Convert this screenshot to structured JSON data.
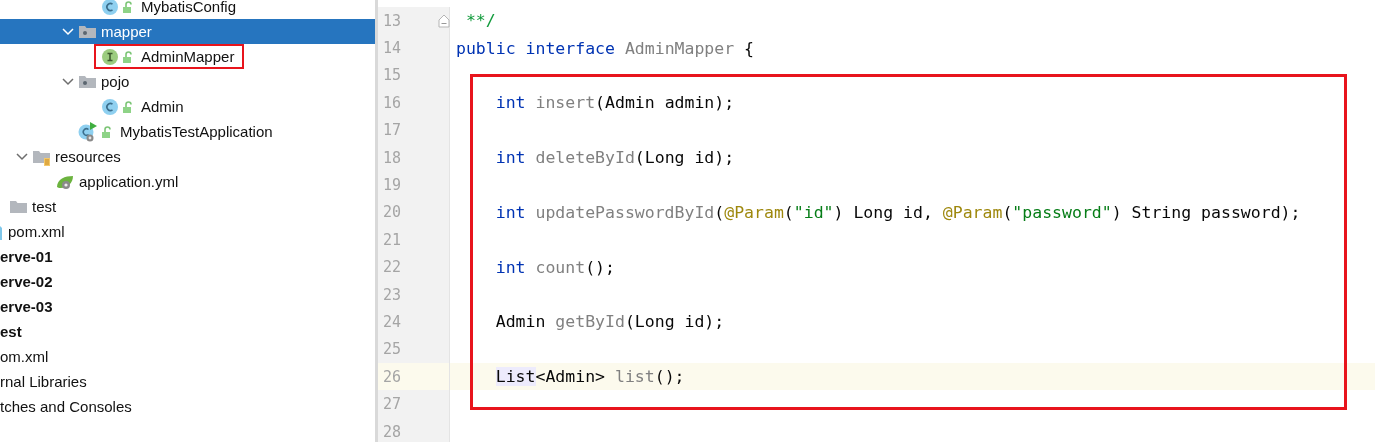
{
  "project_tree": {
    "items": [
      {
        "children": [
          {
            "children": [
              {
                "children": [
                  {
                    "children": [
                      {
                        "children": [
                          {
                            "children": [
                              {
                                "label": "MybatisConfig",
                                "kind": "class",
                                "locked": true,
                                "selected": false
                              }
                            ]
                          },
                          {
                            "label": "mapper",
                            "kind": "package",
                            "expanded": true,
                            "selected": true,
                            "children": [
                              {
                                "label": "AdminMapper",
                                "kind": "interface",
                                "locked": true,
                                "selected": false,
                                "highlighted": true
                              }
                            ]
                          },
                          {
                            "label": "pojo",
                            "kind": "package",
                            "expanded": true,
                            "selected": false,
                            "children": [
                              {
                                "label": "Admin",
                                "kind": "class",
                                "locked": true,
                                "selected": false
                              }
                            ]
                          },
                          {
                            "label": "MybatisTestApplication",
                            "kind": "application",
                            "locked": true,
                            "selected": false
                          }
                        ]
                      }
                    ]
                  },
                  {
                    "label": "resources",
                    "kind": "resources",
                    "expanded": true,
                    "selected": false,
                    "children": [
                      {
                        "label": "application.yml",
                        "kind": "spring_config",
                        "selected": false
                      }
                    ]
                  }
                ]
              },
              {
                "label": "test",
                "kind": "folder",
                "selected": false
              }
            ]
          },
          {
            "label": "pom.xml",
            "kind": "maven",
            "selected": false
          }
        ]
      },
      {
        "label": "erve-01",
        "kind": "module",
        "selected": false
      },
      {
        "label": "erve-02",
        "kind": "module",
        "selected": false
      },
      {
        "label": "erve-03",
        "kind": "module",
        "selected": false
      },
      {
        "label": "est",
        "kind": "module",
        "selected": false
      },
      {
        "label": "om.xml",
        "kind": "file",
        "selected": false
      },
      {
        "label": "rnal Libraries",
        "kind": "file",
        "selected": false
      },
      {
        "label": "tches and Consoles",
        "kind": "file",
        "selected": false
      }
    ]
  },
  "editor": {
    "blocks": [
      {
        "boxed": false,
        "lines": [
          {
            "number": "13",
            "fold": true,
            "tokens": [
              {
                "kind": "doc_comment",
                "text": " **/"
              }
            ]
          },
          {
            "number": "14",
            "tokens": [
              {
                "kind": "keyword",
                "text": "public interface "
              },
              {
                "kind": "unused",
                "text": "AdminMapper"
              },
              {
                "kind": "plain",
                "text": " {"
              }
            ]
          },
          {
            "number": "15"
          }
        ]
      },
      {
        "boxed": true,
        "lines": [
          {
            "number": "16",
            "tokens": [
              {
                "kind": "keyword",
                "text": "    int "
              },
              {
                "kind": "unused",
                "text": "insert"
              },
              {
                "kind": "plain",
                "text": "(Admin admin);"
              }
            ]
          },
          {
            "number": "17"
          },
          {
            "number": "18",
            "tokens": [
              {
                "kind": "keyword",
                "text": "    int "
              },
              {
                "kind": "unused",
                "text": "deleteById"
              },
              {
                "kind": "plain",
                "text": "(Long id);"
              }
            ]
          },
          {
            "number": "19"
          },
          {
            "number": "20",
            "tokens": [
              {
                "kind": "keyword",
                "text": "    int "
              },
              {
                "kind": "unused",
                "text": "updatePasswordById"
              },
              {
                "kind": "plain",
                "text": "("
              },
              {
                "kind": "annotation",
                "text": "@Param"
              },
              {
                "kind": "plain",
                "text": "("
              },
              {
                "kind": "string",
                "text": "\"id\""
              },
              {
                "kind": "plain",
                "text": ") Long id, "
              },
              {
                "kind": "annotation",
                "text": "@Param"
              },
              {
                "kind": "plain",
                "text": "("
              },
              {
                "kind": "string",
                "text": "\"password\""
              },
              {
                "kind": "plain",
                "text": ") String password);"
              }
            ]
          },
          {
            "number": "21"
          },
          {
            "number": "22",
            "tokens": [
              {
                "kind": "keyword",
                "text": "    int "
              },
              {
                "kind": "unused",
                "text": "count"
              },
              {
                "kind": "plain",
                "text": "();"
              }
            ]
          },
          {
            "number": "23"
          },
          {
            "number": "24",
            "tokens": [
              {
                "kind": "plain",
                "text": "    Admin "
              },
              {
                "kind": "unused",
                "text": "getById"
              },
              {
                "kind": "plain",
                "text": "(Long id);"
              }
            ]
          },
          {
            "number": "25"
          },
          {
            "number": "26",
            "current": true,
            "tokens": [
              {
                "kind": "usage",
                "text": "    List"
              },
              {
                "kind": "plain",
                "text": "<Admin> "
              },
              {
                "kind": "unused",
                "text": "list"
              },
              {
                "kind": "plain",
                "text": "();"
              }
            ]
          },
          {
            "number": "27"
          }
        ]
      },
      {
        "boxed": false,
        "lines": [
          {
            "number": "28"
          }
        ]
      }
    ]
  }
}
